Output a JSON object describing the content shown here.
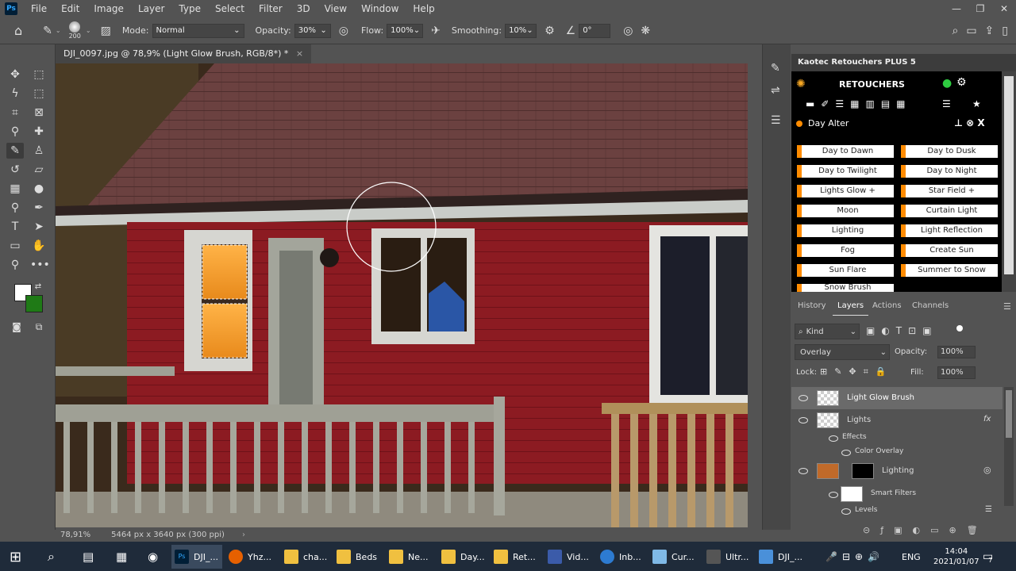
{
  "menubar": {
    "logo": "Ps",
    "items": [
      "File",
      "Edit",
      "Image",
      "Layer",
      "Type",
      "Select",
      "Filter",
      "3D",
      "View",
      "Window",
      "Help"
    ]
  },
  "options": {
    "brush_size": "200",
    "mode_label": "Mode:",
    "mode_value": "Normal",
    "opacity_label": "Opacity:",
    "opacity_value": "30%",
    "flow_label": "Flow:",
    "flow_value": "100%",
    "smoothing_label": "Smoothing:",
    "smoothing_value": "10%",
    "angle_value": "0°"
  },
  "document": {
    "tab_title": "DJI_0097.jpg @ 78,9% (Light Glow Brush, RGB/8*) *",
    "close_glyph": "×",
    "zoom": "78,91%",
    "size_info": "5464 px x 3640 px (300 ppi)"
  },
  "colors": {
    "foreground": "#ffffff",
    "background": "#1f7a16",
    "accent_orange": "#ff8c00"
  },
  "kaotec": {
    "panel_title": "Kaotec Retouchers PLUS 5",
    "header": "RETOUCHERS",
    "section": "Day Alter",
    "buttons_left": [
      "Day to Dawn",
      "Day to Twilight",
      "Lights Glow +",
      "Moon",
      "Lighting",
      "Fog",
      "Sun Flare",
      "Snow Brush"
    ],
    "buttons_right": [
      "Day to Dusk",
      "Day to Night",
      "Star Field +",
      "Curtain Light",
      "Light Reflection",
      "Create Sun",
      "Summer to Snow"
    ]
  },
  "layers": {
    "tabs": [
      "History",
      "Layers",
      "Actions",
      "Channels"
    ],
    "kind_label": "Kind",
    "blend_mode": "Overlay",
    "opacity_label": "Opacity:",
    "opacity_value": "100%",
    "lock_label": "Lock:",
    "fill_label": "Fill:",
    "fill_value": "100%",
    "items": [
      {
        "name": "Light Glow Brush"
      },
      {
        "name": "Lights"
      },
      {
        "name": "Effects"
      },
      {
        "name": "Color Overlay"
      },
      {
        "name": "Lighting"
      },
      {
        "name": "Smart Filters"
      },
      {
        "name": "Levels"
      }
    ],
    "fx_label": "fx"
  },
  "taskbar": {
    "items": [
      "DJI_...",
      "Yhz...",
      "cha...",
      "Beds",
      "Ne...",
      "Day...",
      "Ret...",
      "Vid...",
      "Inb...",
      "Cur...",
      "Ultr...",
      "DJI_..."
    ],
    "lang": "ENG",
    "time": "14:04",
    "date": "2021/01/07",
    "notifications": "7"
  }
}
